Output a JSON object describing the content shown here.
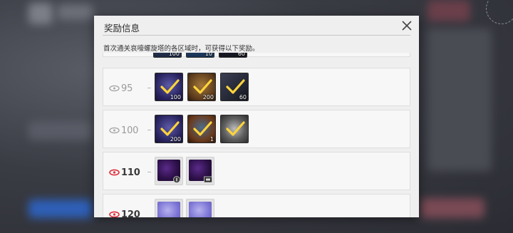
{
  "dialog": {
    "title": "奖励信息",
    "description": "首次通关哀嚎螺旋塔的各区域时，可获得以下奖励。",
    "close_icon": "close-icon"
  },
  "colors": {
    "tier_grey": "#9a9a9a",
    "tier_red": "#e0303a",
    "dialog_bg": "#efefef",
    "check_gold": "#ffd43a"
  },
  "rows": [
    {
      "tier": "",
      "rank_style": "grey",
      "items": [
        {
          "icon": "bag-icon",
          "qty": "100"
        },
        {
          "icon": "box-icon",
          "qty": "10"
        },
        {
          "icon": "cube-icon",
          "qty": "60"
        }
      ]
    },
    {
      "tier": "95",
      "rank_style": "grey",
      "items": [
        {
          "icon": "purple-crystal-icon",
          "qty": "100",
          "claimed": true
        },
        {
          "icon": "gold-crystal-icon",
          "qty": "200",
          "claimed": true
        },
        {
          "icon": "shard-icon",
          "qty": "60",
          "claimed": true
        }
      ]
    },
    {
      "tier": "100",
      "rank_style": "grey",
      "items": [
        {
          "icon": "purple-crystal-icon",
          "qty": "200",
          "claimed": true
        },
        {
          "icon": "orange-box-icon",
          "qty": "1",
          "claimed": true
        },
        {
          "icon": "grey-mask-icon",
          "qty": "",
          "claimed": true
        }
      ]
    },
    {
      "tier": "110",
      "rank_style": "red",
      "items": [
        {
          "icon": "purple-card-icon",
          "qty": "",
          "badge": "coin-badge-icon"
        },
        {
          "icon": "purple-card-icon",
          "qty": "",
          "badge": "ticket-badge-icon"
        }
      ]
    },
    {
      "tier": "120",
      "rank_style": "red",
      "items": [
        {
          "icon": "lavender-card-icon",
          "qty": ""
        },
        {
          "icon": "lavender-card-icon",
          "qty": ""
        }
      ]
    }
  ]
}
